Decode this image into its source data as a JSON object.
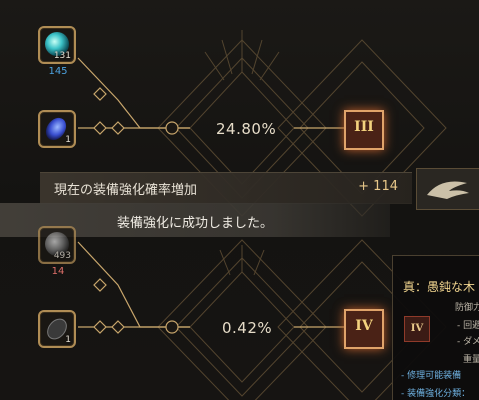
{
  "upper": {
    "material_top": {
      "count": "131",
      "sub": "145"
    },
    "material_bottom": {
      "count": "1"
    },
    "rate": "24.80%",
    "grade": "III"
  },
  "banner": {
    "label": "現在の装備強化確率増加",
    "value": "+ 114"
  },
  "toast": {
    "message": "装備強化に成功しました。"
  },
  "lower": {
    "material_top": {
      "count": "493",
      "sub": "14"
    },
    "material_bottom": {
      "count": "1"
    },
    "rate": "0.42%",
    "grade": "IV"
  },
  "tooltip": {
    "title": "真：愚鈍な木",
    "line1": "防御力",
    "line2": "- 回避",
    "line3": "- ダメ",
    "line4": "重量",
    "line5": "- 修理可能装備",
    "line6": "- 装備強化分類：",
    "grade": "IV"
  },
  "colors": {
    "gold": "#b08d55",
    "sub_blue": "#4da3e0",
    "sub_red": "#e0706a"
  }
}
